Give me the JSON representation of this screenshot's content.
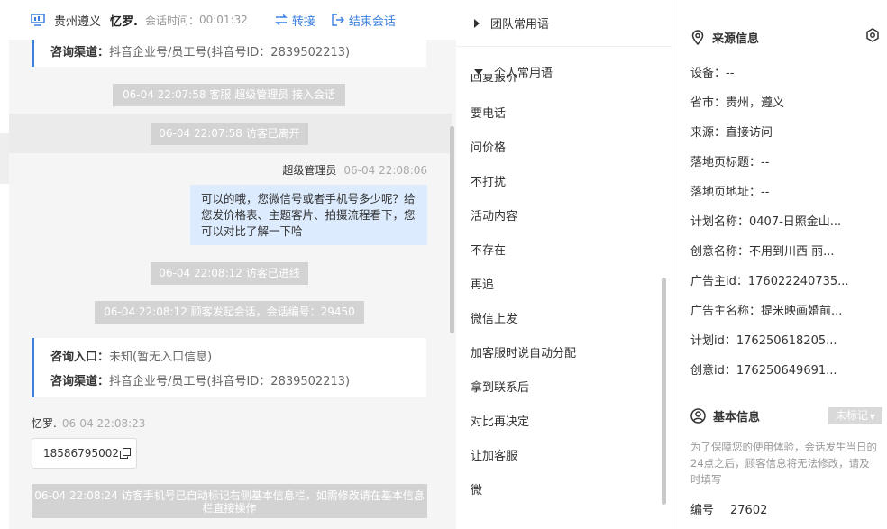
{
  "chat": {
    "header": {
      "location": "贵州遵义",
      "name": "忆罗.",
      "time_label": "会话时间：",
      "time": "00:01:32",
      "transfer": "转接",
      "end": "结束会话"
    },
    "card_top": {
      "channel_label": "咨询渠道：",
      "channel_value": "抖音企业号/员工号(抖音号ID：2839502213)"
    },
    "sys_join": "06-04 22:07:58 客服 超级管理员 接入会话",
    "sys_left": "06-04 22:07:58 访客已离开",
    "agent_name": "超级管理员",
    "agent_time": "06-04 22:08:06",
    "agent_message": "可以的哦，您微信号或者手机号多少呢？给您发价格表、主题客片、拍摄流程看下，您可以对比了解一下哈",
    "sys_enter": "06-04 22:08:12 访客已进线",
    "sys_start": "06-04 22:08:12 顾客发起会话，会话编号：29450",
    "card_bottom": {
      "entry_label": "咨询入口：",
      "entry_value": "未知(暂无入口信息)",
      "channel_label": "咨询渠道：",
      "channel_value": "抖音企业号/员工号(抖音号ID：2839502213)"
    },
    "visitor_name": "忆罗.",
    "visitor_time": "06-04 22:08:23",
    "visitor_phone": "18586795002",
    "sys_auto": "06-04 22:08:24 访客手机号已自动标记右侧基本信息栏，如需修改请在基本信息栏直接操作"
  },
  "phrases": {
    "team_label": "团队常用语",
    "personal_label": "个人常用语",
    "partial_item": "回复报价",
    "items": [
      "要电话",
      "问价格",
      "不打扰",
      "活动内容",
      "不存在",
      "再追",
      "微信上发",
      "加客服时说自动分配",
      "拿到联系后",
      "对比再决定",
      "让加客服",
      "微"
    ]
  },
  "info": {
    "source_title": "来源信息",
    "rows": [
      {
        "k": "设备：",
        "v": "--"
      },
      {
        "k": "省市：",
        "v": "贵州，遵义"
      },
      {
        "k": "来源：",
        "v": "直接访问"
      },
      {
        "k": "落地页标题：",
        "v": "--"
      },
      {
        "k": "落地页地址：",
        "v": "--"
      },
      {
        "k": "计划名称：",
        "v": "0407-日照金山..."
      },
      {
        "k": "创意名称：",
        "v": "不用到川西 丽..."
      },
      {
        "k": "广告主id：",
        "v": "176022240735..."
      },
      {
        "k": "广告主名称：",
        "v": "提米映画婚前..."
      },
      {
        "k": "计划id：",
        "v": "176250618205..."
      },
      {
        "k": "创意id：",
        "v": "176250649691..."
      }
    ],
    "basic_title": "基本信息",
    "tag": "未标记",
    "hint": "为了保障您的使用体验，会话发生当日的24点之后，顾客信息将无法修改，请及时填写",
    "id_label": "编号",
    "id_value": "27602"
  },
  "colors": {
    "accent": "#3a7fe0",
    "bubble": "#dcebfd",
    "system": "#d3d3d3"
  },
  "icons": [
    "monitor-icon",
    "transfer-icon",
    "exit-icon",
    "copy-icon",
    "location-pin-icon",
    "settings-icon",
    "user-circle-icon",
    "triangle-right-icon",
    "triangle-down-icon"
  ]
}
